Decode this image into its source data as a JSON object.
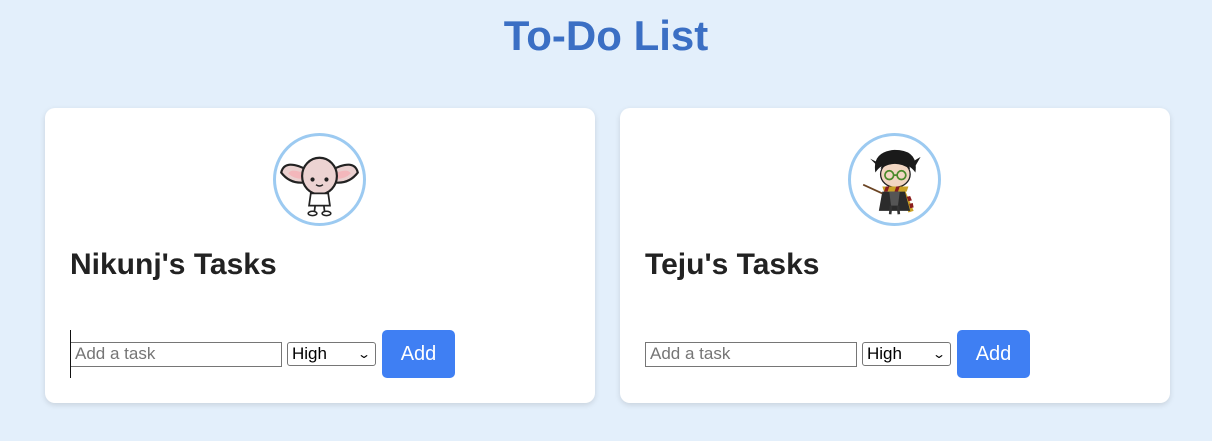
{
  "page": {
    "title": "To-Do List"
  },
  "cards": [
    {
      "heading": "Nikunj's Tasks",
      "avatar_icon": "elf-character-icon",
      "input_placeholder": "Add a task",
      "priority_selected": "High",
      "add_label": "Add"
    },
    {
      "heading": "Teju's Tasks",
      "avatar_icon": "wizard-character-icon",
      "input_placeholder": "Add a task",
      "priority_selected": "High",
      "add_label": "Add"
    }
  ],
  "colors": {
    "title": "#3b6fc4",
    "background": "#e3effb",
    "button": "#3f7ff3",
    "avatar_border": "#9ccaf1"
  }
}
